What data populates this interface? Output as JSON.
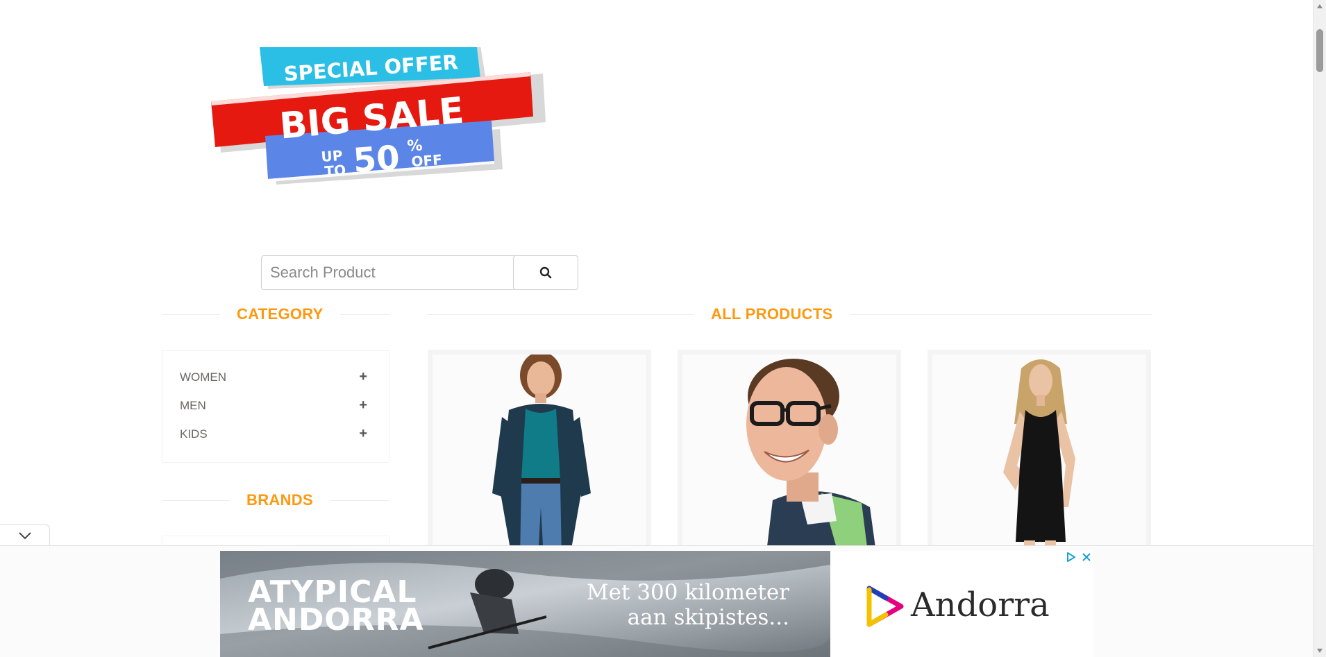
{
  "banner": {
    "line1": "SPECIAL OFFER",
    "line2": "BIG SALE",
    "line3_up": "UP",
    "line3_to": "TO",
    "line3_value": "50",
    "line3_pct": "%",
    "line3_off": "OFF"
  },
  "search": {
    "placeholder": "Search Product",
    "button_icon": "search-icon"
  },
  "sidebar": {
    "category_title": "CATEGORY",
    "categories": [
      {
        "label": "WOMEN",
        "icon": "plus-icon"
      },
      {
        "label": "MEN",
        "icon": "plus-icon"
      },
      {
        "label": "KIDS",
        "icon": "plus-icon"
      }
    ],
    "brands_title": "BRANDS"
  },
  "main": {
    "title": "ALL PRODUCTS",
    "products": [
      {
        "image": "woman-casual-photo"
      },
      {
        "image": "man-glasses-photo"
      },
      {
        "image": "woman-black-dress-photo"
      }
    ]
  },
  "ad": {
    "brand_line1": "ATYPICAL",
    "brand_line2": "ANDORRA",
    "copy_line1": "Met 300 kilometer",
    "copy_line2": "aan skipistes...",
    "logo_text": "Andorra",
    "controls": [
      "adchoices-icon",
      "close-icon"
    ],
    "collapse_icon": "chevron-down-icon"
  },
  "colors": {
    "accent": "#fe980f",
    "banner_red": "#e5190f",
    "banner_cyan": "#2bbfe6",
    "banner_blue": "#5b86e8",
    "ad_control": "#1a9fd6"
  }
}
